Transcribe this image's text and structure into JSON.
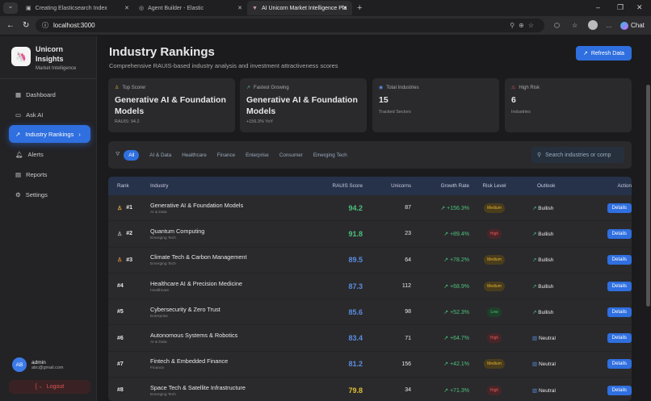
{
  "browser": {
    "tabs": [
      {
        "label": "Creating Elasticsearch Index"
      },
      {
        "label": "Agent Builder - Elastic"
      },
      {
        "label": "AI Unicorn Market Intelligence Pla"
      }
    ],
    "url": "localhost:3000",
    "chat_label": "Chat"
  },
  "sidebar": {
    "brand": "Unicorn Insights",
    "tagline": "Market Intelligence",
    "items": [
      {
        "label": "Dashboard"
      },
      {
        "label": "Ask AI"
      },
      {
        "label": "Industry Rankings"
      },
      {
        "label": "Alerts"
      },
      {
        "label": "Reports"
      },
      {
        "label": "Settings"
      }
    ],
    "user": {
      "initials": "AB",
      "name": "admin",
      "email": "abc@gmail.com"
    },
    "logout": "Logout"
  },
  "header": {
    "title": "Industry Rankings",
    "subtitle": "Comprehensive RAUIS-based industry analysis and investment attractiveness scores",
    "refresh": "Refresh Data"
  },
  "cards": [
    {
      "label": "Top Scorer",
      "value": "Generative AI & Foundation Models",
      "note": "RAUIS: 94.2"
    },
    {
      "label": "Fastest Growing",
      "value": "Generative AI & Foundation Models",
      "note": "+156.3% YoY"
    },
    {
      "label": "Total Industries",
      "value": "15",
      "note": "Tracked Sectors"
    },
    {
      "label": "High Risk",
      "value": "6",
      "note": "Industries"
    }
  ],
  "filters": [
    "All",
    "AI & Data",
    "Healthcare",
    "Finance",
    "Enterprise",
    "Consumer",
    "Emerging Tech"
  ],
  "search_placeholder": "Search industries or comp",
  "columns": [
    "Rank",
    "Industry",
    "RAUIS Score",
    "Unicorns",
    "Growth Rate",
    "Risk Level",
    "Outlook",
    "Action"
  ],
  "rows": [
    {
      "rank": "#1",
      "name": "Generative AI & Foundation Models",
      "cat": "AI & Data",
      "score": "94.2",
      "unicorns": "87",
      "growth": "+156.3%",
      "risk": "Medium",
      "outlook": "Bullish",
      "action": "Details"
    },
    {
      "rank": "#2",
      "name": "Quantum Computing",
      "cat": "Emerging Tech",
      "score": "91.8",
      "unicorns": "23",
      "growth": "+89.4%",
      "risk": "High",
      "outlook": "Bullish",
      "action": "Details"
    },
    {
      "rank": "#3",
      "name": "Climate Tech & Carbon Management",
      "cat": "Emerging Tech",
      "score": "89.5",
      "unicorns": "64",
      "growth": "+78.2%",
      "risk": "Medium",
      "outlook": "Bullish",
      "action": "Details"
    },
    {
      "rank": "#4",
      "name": "Healthcare AI & Precision Medicine",
      "cat": "Healthcare",
      "score": "87.3",
      "unicorns": "112",
      "growth": "+68.9%",
      "risk": "Medium",
      "outlook": "Bullish",
      "action": "Details"
    },
    {
      "rank": "#5",
      "name": "Cybersecurity & Zero Trust",
      "cat": "Enterprise",
      "score": "85.6",
      "unicorns": "98",
      "growth": "+52.3%",
      "risk": "Low",
      "outlook": "Bullish",
      "action": "Details"
    },
    {
      "rank": "#6",
      "name": "Autonomous Systems & Robotics",
      "cat": "AI & Data",
      "score": "83.4",
      "unicorns": "71",
      "growth": "+64.7%",
      "risk": "High",
      "outlook": "Neutral",
      "action": "Details"
    },
    {
      "rank": "#7",
      "name": "Fintech & Embedded Finance",
      "cat": "Finance",
      "score": "81.2",
      "unicorns": "156",
      "growth": "+42.1%",
      "risk": "Medium",
      "outlook": "Neutral",
      "action": "Details"
    },
    {
      "rank": "#8",
      "name": "Space Tech & Satellite Infrastructure",
      "cat": "Emerging Tech",
      "score": "79.8",
      "unicorns": "34",
      "growth": "+71.3%",
      "risk": "High",
      "outlook": "Neutral",
      "action": "Details"
    }
  ]
}
